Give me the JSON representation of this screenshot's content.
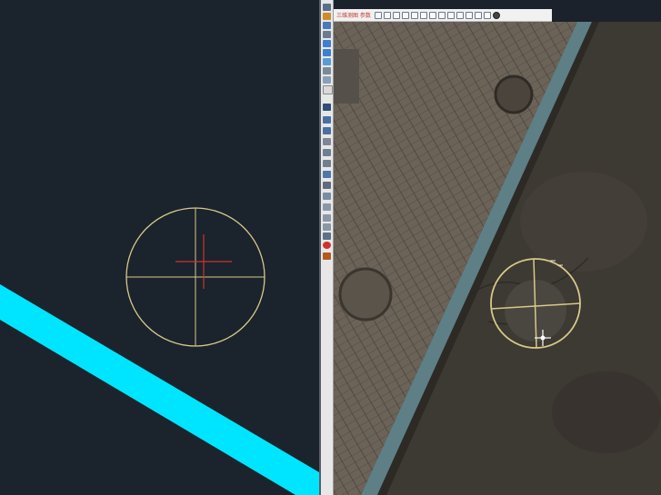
{
  "toolbar": {
    "title": "三维测图 参数"
  },
  "colors": {
    "cad_background": "#1b232d",
    "cad_polyline": "#00e5ff",
    "marker_circle": "#d8c98a",
    "crosshair": "#d0332b",
    "road": "#3d3933",
    "sidewalk": "#6e665b",
    "curb": "#5e7f86"
  },
  "icons": {
    "tool_strip": [
      "pointer-icon",
      "pencil-icon",
      "triangle-icon",
      "grid-icon",
      "rectangle-icon",
      "rectangle-icon",
      "diamond-icon",
      "gear-icon",
      "layer-icon",
      "square-icon",
      "box-icon",
      "cube-icon",
      "cube-icon",
      "line-icon",
      "tile-icon",
      "tile-icon",
      "shape-icon",
      "text-icon",
      "stamp-icon",
      "measure-icon",
      "tool-icon",
      "tool-icon",
      "ruler-icon",
      "brush-icon",
      "pen-icon",
      "globe-icon"
    ],
    "top_toolbar": [
      "file-icon",
      "open-icon",
      "save-icon",
      "grid-icon",
      "view-icon",
      "layer-icon",
      "draw-icon",
      "edit-icon",
      "snap-icon",
      "measure-icon",
      "zoom-icon",
      "pan-icon",
      "settings-icon",
      "record-icon"
    ]
  }
}
